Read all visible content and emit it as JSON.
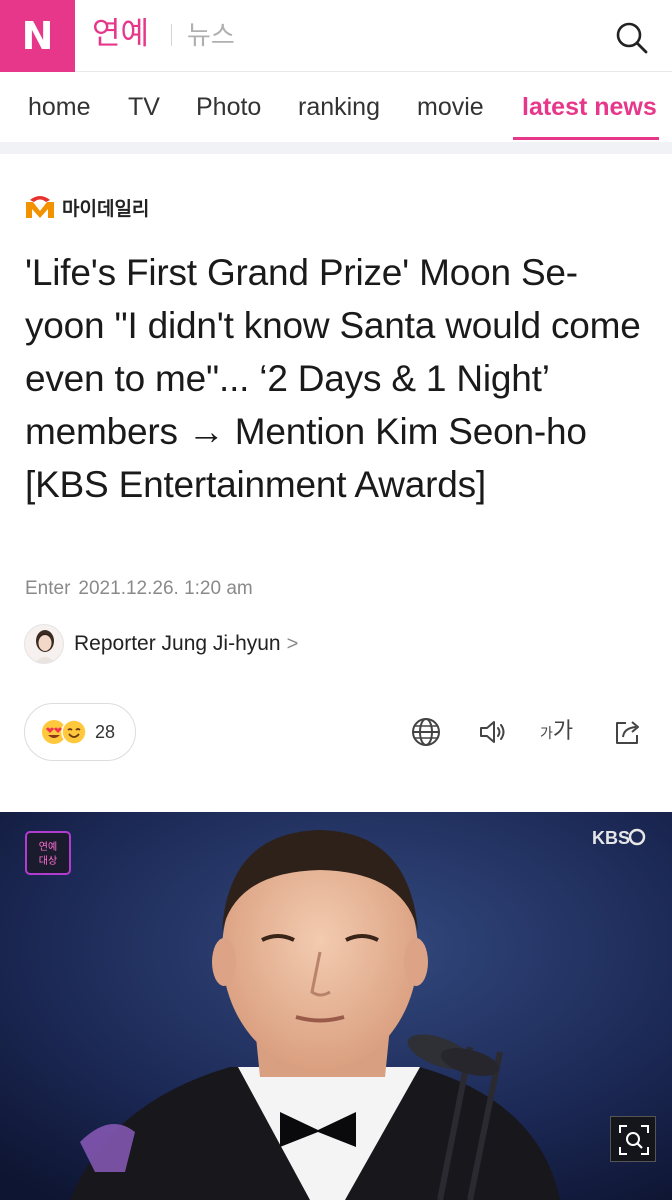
{
  "header": {
    "logo_letter": "N",
    "section_title": "연예",
    "section_sub": "뉴스"
  },
  "tabs": [
    {
      "label": "home"
    },
    {
      "label": "TV"
    },
    {
      "label": "Photo"
    },
    {
      "label": "ranking"
    },
    {
      "label": "movie"
    },
    {
      "label": "latest news",
      "active": true
    }
  ],
  "article": {
    "press_name": "마이데일리",
    "headline": "'Life's First Grand Prize' Moon Se-yoon \"I didn't know Santa would come even to me\"... ‘2 Days & 1 Night’ members → Mention Kim Seon-ho [KBS Entertainment Awards]",
    "date_label": "Enter",
    "date_value": "2021.12.26. 1:20 am",
    "reporter": "Reporter Jung Ji-hyun",
    "reporter_chevron": ">"
  },
  "reactions": {
    "count": "28"
  },
  "tools": {
    "font_small": "가",
    "font_big": "가"
  },
  "photo": {
    "broadcaster_logo": "KBS",
    "show_badge": "연예 대상"
  },
  "colors": {
    "brand": "#e6378a",
    "press_red": "#e8332c",
    "press_orange": "#f29200"
  }
}
